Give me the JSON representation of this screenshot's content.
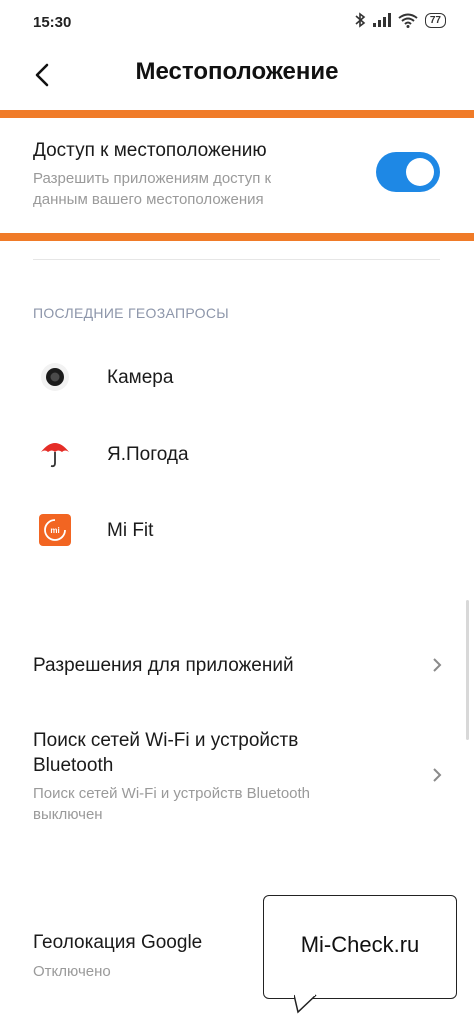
{
  "status_bar": {
    "time": "15:30",
    "battery": "77"
  },
  "header": {
    "title": "Местоположение"
  },
  "location_access": {
    "title": "Доступ к местоположению",
    "subtitle_line1": "Разрешить приложениям доступ к",
    "subtitle_line2": "данным вашего местоположения",
    "enabled": true
  },
  "recent_requests": {
    "heading": "ПОСЛЕДНИЕ ГЕОЗАПРОСЫ",
    "apps": [
      {
        "label": "Камера",
        "icon": "camera-icon"
      },
      {
        "label": "Я.Погода",
        "icon": "umbrella-icon"
      },
      {
        "label": "Mi Fit",
        "icon": "mi-fit-icon"
      }
    ]
  },
  "settings": {
    "app_permissions": {
      "title": "Разрешения для приложений"
    },
    "wifi_bt_scan": {
      "title_line1": "Поиск сетей Wi-Fi и устройств",
      "title_line2": "Bluetooth",
      "sub_line1": "Поиск сетей Wi-Fi и устройств Bluetooth",
      "sub_line2": "выключен"
    },
    "google_location": {
      "title": "Геолокация Google",
      "status": "Отключено"
    }
  },
  "watermark": {
    "text": "Mi-Check.ru"
  },
  "colors": {
    "accent": "#1e88e5",
    "highlight": "#f07b28"
  }
}
